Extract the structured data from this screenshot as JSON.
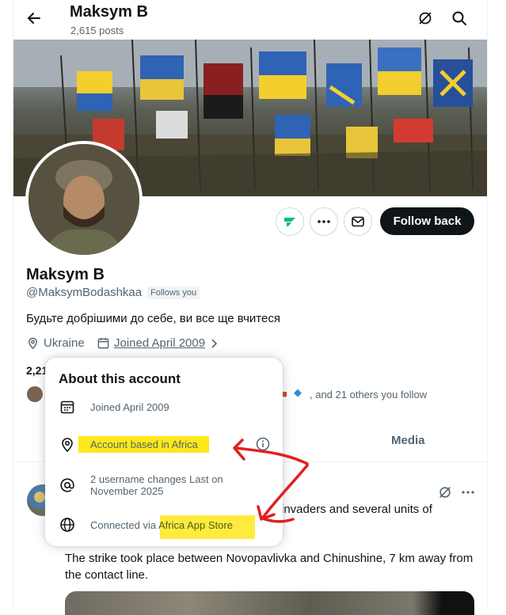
{
  "header": {
    "title": "Maksym B",
    "posts": "2,615 posts"
  },
  "profile": {
    "name": "Maksym B",
    "handle": "@MaksymBodashkaa",
    "follows_badge": "Follows you",
    "bio": "Будьте добрішими до себе, ви все ще вчитеся",
    "location": "Ukraine",
    "joined": "Joined April 2009",
    "counts_visible": "2,21",
    "followers_you_know": ", and 21 others you follow",
    "follow_back_label": "Follow back"
  },
  "tabs": {
    "media": "Media"
  },
  "popup": {
    "title": "About this account",
    "joined": "Joined April 2009",
    "based_in": "Account based in Africa",
    "username_changes": [
      "2 username changes Last on",
      "November 2025"
    ],
    "connected": "Connected via Africa App Store"
  },
  "post": {
    "text_fragment": "invaders and several units of",
    "text2": "The strike took place between Novopavlivka and Chinushine, 7 km away from the contact line."
  },
  "colors": {
    "highlight": "#ffe81a",
    "annotation": "#e02020",
    "button_dark": "#0f1419",
    "muted": "#536471"
  }
}
